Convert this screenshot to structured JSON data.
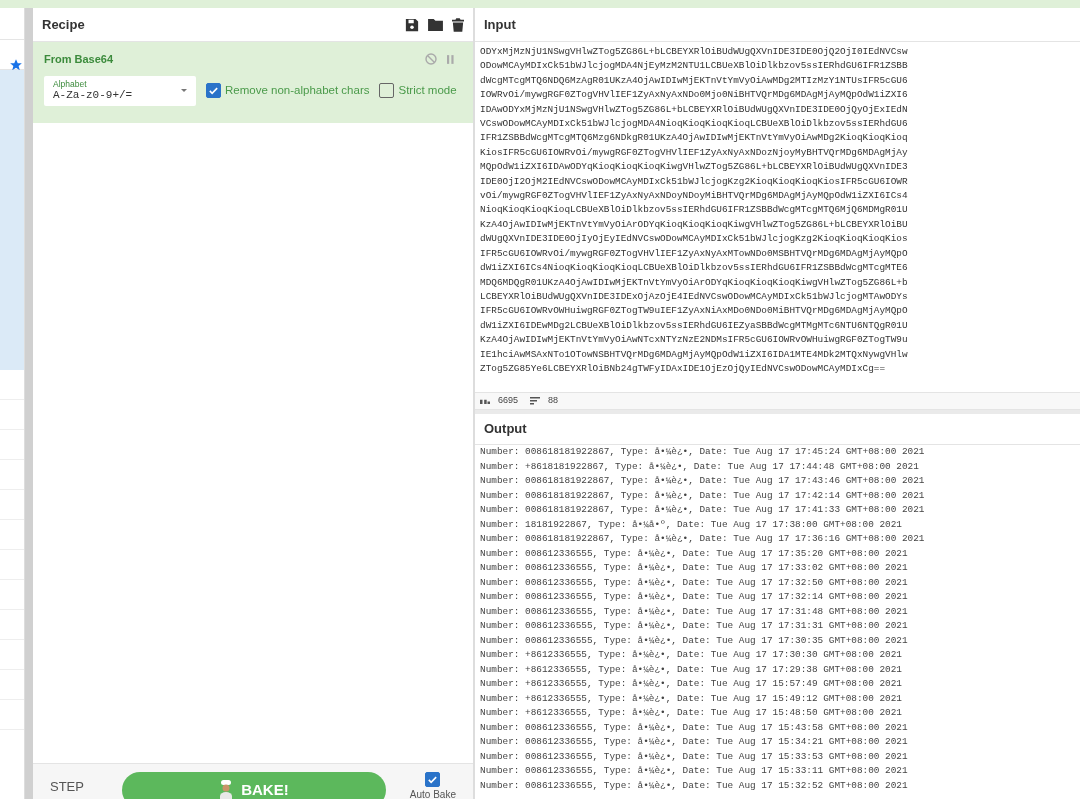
{
  "recipe": {
    "title": "Recipe",
    "operation": {
      "name": "From Base64",
      "alphabet_label": "Alphabet",
      "alphabet_value": "A-Za-z0-9+/=",
      "options": [
        {
          "label": "Remove non-alphabet chars",
          "checked": true
        },
        {
          "label": "Strict mode",
          "checked": false
        }
      ]
    },
    "step": "STEP",
    "bake": "BAKE!",
    "auto_bake": {
      "label": "Auto Bake",
      "checked": true
    }
  },
  "input": {
    "title": "Input",
    "lines": [
      "ODYxMjMzNjU1NSwgVHlwZTog5ZG86L+bLCBEYXRlOiBUdWUgQXVnIDE3IDE0OjQ2OjI0IEdNVCsw",
      "ODowMCAyMDIxCk51bWJlcjogMDA4NjEyMzM2NTU1LCBUeXBlOiDlkbzov5ssIERhdGU6IFR1ZSBB",
      "dWcgMTcgMTQ6NDQ6MzAgR01UKzA4OjAwIDIwMjEKTnVtYmVyOiAwMDg2MTIzMzY1NTUsIFR5cGU6",
      "IOWRvOi/mywgRGF0ZTogVHVlIEF1ZyAxNyAxNDo0Mjo0NiBHTVQrMDg6MDAgMjAyMQpOdW1iZXI6",
      "IDAwODYxMjMzNjU1NSwgVHlwZTog5ZG86L+bLCBEYXRlOiBUdWUgQXVnIDE3IDE0OjQyOjExIEdN",
      "VCswODowMCAyMDIxCk51bWJlcjogMDA4NioqKioqKioqKioqLCBUeXBlOiDlkbzov5ssIERhdGU6",
      "IFR1ZSBBdWcgMTcgMTQ6Mzg6NDkgR01UKzA4OjAwIDIwMjEKTnVtYmVyOiAwMDg2KioqKioqKioq",
      "KiosIFR5cGU6IOWRvOi/mywgRGF0ZTogVHVlIEF1ZyAxNyAxNDozNjoyMyBHTVQrMDg6MDAgMjAy",
      "MQpOdW1iZXI6IDAwODYqKioqKioqKioqKiwgVHlwZTog5ZG86L+bLCBEYXRlOiBUdWUgQXVnIDE3",
      "IDE0OjI2OjM2IEdNVCswODowMCAyMDIxCk51bWJlcjogKzg2KioqKioqKioqKiosIFR5cGU6IOWR",
      "vOi/mywgRGF0ZTogVHVlIEF1ZyAxNyAxNDoyNDoyMiBHTVQrMDg6MDAgMjAyMQpOdW1iZXI6ICs4",
      "NioqKioqKioqKioqLCBUeXBlOiDlkbzov5ssIERhdGU6IFR1ZSBBdWcgMTcgMTQ6MjQ6MDMgR01U",
      "KzA4OjAwIDIwMjEKTnVtYmVyOiArODYqKioqKioqKioqKiwgVHlwZTog5ZG86L+bLCBEYXRlOiBU",
      "dWUgQXVnIDE3IDE0OjIyOjEyIEdNVCswODowMCAyMDIxCk51bWJlcjogKzg2KioqKioqKioqKios",
      "IFR5cGU6IOWRvOi/mywgRGF0ZTogVHVlIEF1ZyAxNyAxMTowNDo0MSBHTVQrMDg6MDAgMjAyMQpO",
      "dW1iZXI6ICs4NioqKioqKioqKioqLCBUeXBlOiDlkbzov5ssIERhdGU6IFR1ZSBBdWcgMTcgMTE6",
      "MDQ6MDQgR01UKzA4OjAwIDIwMjEKTnVtYmVyOiArODYqKioqKioqKioqKiwgVHlwZTog5ZG86L+b",
      "LCBEYXRlOiBUdWUgQXVnIDE3IDExOjAzOjE4IEdNVCswODowMCAyMDIxCk51bWJlcjogMTAwODYs",
      "IFR5cGU6IOWRvOWHuiwgRGF0ZTogTW9uIEF1ZyAxNiAxMDo0NDo0MiBHTVQrMDg6MDAgMjAyMQpO",
      "dW1iZXI6IDEwMDg2LCBUeXBlOiDlkbzov5ssIERhdGU6IEZyaSBBdWcgMTMgMTc6NTU6NTQgR01U",
      "KzA4OjAwIDIwMjEKTnVtYmVyOiAwNTcxNTYzNzE2NDMsIFR5cGU6IOWRvOWHuiwgRGF0ZTogTW9u",
      "IE1hciAwMSAxNTo1OTowNSBHTVQrMDg6MDAgMjAyMQpOdW1iZXI6IDA1MTE4MDk2MTQxNywgVHlw",
      "ZTog5ZG85Ye6LCBEYXRlOiBNb24gTWFyIDAxIDE1OjEzOjQyIEdNVCswODowMCAyMDIxCg=="
    ],
    "length": "6695",
    "line_count": "88"
  },
  "output": {
    "title": "Output",
    "lines": [
      "Number: 008618181922867, Type: å•¼è¿•, Date: Tue Aug 17 17:45:24 GMT+08:00 2021",
      "Number: +8618181922867, Type: å•¼è¿•, Date: Tue Aug 17 17:44:48 GMT+08:00 2021",
      "Number: 008618181922867, Type: å•¼è¿•, Date: Tue Aug 17 17:43:46 GMT+08:00 2021",
      "Number: 008618181922867, Type: å•¼è¿•, Date: Tue Aug 17 17:42:14 GMT+08:00 2021",
      "Number: 008618181922867, Type: å•¼è¿•, Date: Tue Aug 17 17:41:33 GMT+08:00 2021",
      "Number: 18181922867, Type: å•¼å•º, Date: Tue Aug 17 17:38:00 GMT+08:00 2021",
      "Number: 008618181922867, Type: å•¼è¿•, Date: Tue Aug 17 17:36:16 GMT+08:00 2021",
      "Number: 008612336555, Type: å•¼è¿•, Date: Tue Aug 17 17:35:20 GMT+08:00 2021",
      "Number: 008612336555, Type: å•¼è¿•, Date: Tue Aug 17 17:33:02 GMT+08:00 2021",
      "Number: 008612336555, Type: å•¼è¿•, Date: Tue Aug 17 17:32:50 GMT+08:00 2021",
      "Number: 008612336555, Type: å•¼è¿•, Date: Tue Aug 17 17:32:14 GMT+08:00 2021",
      "Number: 008612336555, Type: å•¼è¿•, Date: Tue Aug 17 17:31:48 GMT+08:00 2021",
      "Number: 008612336555, Type: å•¼è¿•, Date: Tue Aug 17 17:31:31 GMT+08:00 2021",
      "Number: 008612336555, Type: å•¼è¿•, Date: Tue Aug 17 17:30:35 GMT+08:00 2021",
      "Number: +8612336555, Type: å•¼è¿•, Date: Tue Aug 17 17:30:30 GMT+08:00 2021",
      "Number: +8612336555, Type: å•¼è¿•, Date: Tue Aug 17 17:29:38 GMT+08:00 2021",
      "Number: +8612336555, Type: å•¼è¿•, Date: Tue Aug 17 15:57:49 GMT+08:00 2021",
      "Number: +8612336555, Type: å•¼è¿•, Date: Tue Aug 17 15:49:12 GMT+08:00 2021",
      "Number: +8612336555, Type: å•¼è¿•, Date: Tue Aug 17 15:48:50 GMT+08:00 2021",
      "Number: 008612336555, Type: å•¼è¿•, Date: Tue Aug 17 15:43:58 GMT+08:00 2021",
      "Number: 008612336555, Type: å•¼è¿•, Date: Tue Aug 17 15:34:21 GMT+08:00 2021",
      "Number: 008612336555, Type: å•¼è¿•, Date: Tue Aug 17 15:33:53 GMT+08:00 2021",
      "Number: 008612336555, Type: å•¼è¿•, Date: Tue Aug 17 15:33:11 GMT+08:00 2021",
      "Number: 008612336555, Type: å•¼è¿•, Date: Tue Aug 17 15:32:52 GMT+08:00 2021"
    ]
  }
}
